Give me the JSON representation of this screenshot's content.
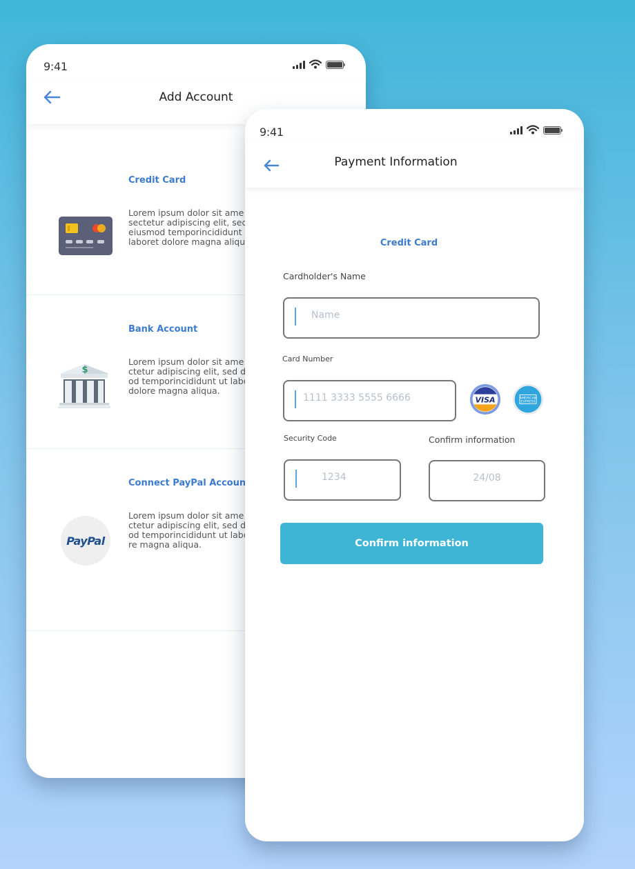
{
  "back_screen": {
    "status": {
      "time": "9:41"
    },
    "header": {
      "title": "Add Account"
    },
    "options": [
      {
        "title": "Credit Card",
        "description": "Lorem ipsum dolor sit ame\nsectetur adipiscing elit, sed\neiusmod temporincididunt\nlaboret dolore magna aliqu",
        "icon": "credit-card-icon"
      },
      {
        "title": "Bank Account",
        "description": "Lorem ipsum dolor sit ame\nctetur adipiscing elit, sed d\nod temporincididunt ut labo\ndolore magna aliqua.",
        "icon": "bank-icon"
      },
      {
        "title": "Connect PayPal Account",
        "description": "Lorem ipsum dolor sit ame\nctetur adipiscing elit, sed d\nod temporincididunt ut labo\nre magna aliqua.",
        "icon": "paypal-icon",
        "logo_text": "PayPal"
      }
    ]
  },
  "front_screen": {
    "status": {
      "time": "9:41"
    },
    "header": {
      "title": "Payment Information"
    },
    "form": {
      "section_title": "Credit Card",
      "name_label": "Cardholder's Name",
      "name_placeholder": "Name",
      "card_label": "Card Number",
      "card_placeholder": "1111 3333 5555 6666",
      "security_label": "Security Code",
      "security_placeholder": "1234",
      "expiry_label": "Confirm information",
      "expiry_placeholder": "24/08",
      "submit_label": "Confirm information"
    },
    "card_brands": [
      {
        "name": "VISA",
        "icon": "visa-icon"
      },
      {
        "name": "AMERICAN EXPRESS",
        "icon": "amex-icon"
      }
    ]
  },
  "colors": {
    "accent": "#3c7bd0",
    "button": "#3fb5d6",
    "background_top": "#40b6d9",
    "background_bottom": "#b2d3fb"
  }
}
